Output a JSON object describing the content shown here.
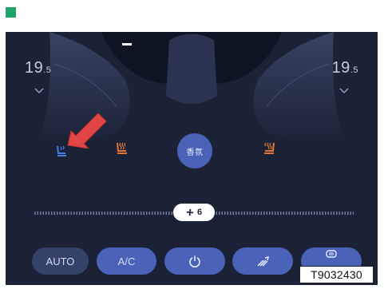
{
  "temperature": {
    "left": {
      "value": "19",
      "decimal": ".5"
    },
    "right": {
      "value": "19",
      "decimal": ".5"
    }
  },
  "center_button": {
    "label": "香氛"
  },
  "fan": {
    "label": "6",
    "icon": "fan-icon",
    "level": 0.55
  },
  "buttons": {
    "auto": "AUTO",
    "ac": "A/C"
  },
  "caption": "T9032430",
  "colors": {
    "screen_bg": "#1b2236",
    "accent": "#4a62b8",
    "seat_heat_orange": "#e1752f",
    "seat_vent_blue": "#3f7ee0",
    "arrow_red": "#e04646",
    "marker_green": "#1fa36b"
  }
}
